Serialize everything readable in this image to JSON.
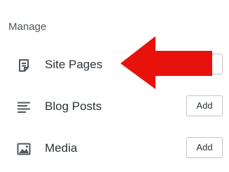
{
  "sidebar": {
    "section_title": "Manage",
    "items": [
      {
        "label": "Site Pages",
        "icon": "page-icon",
        "action_label": "Add"
      },
      {
        "label": "Blog Posts",
        "icon": "posts-icon",
        "action_label": "Add"
      },
      {
        "label": "Media",
        "icon": "media-icon",
        "action_label": "Add"
      }
    ]
  },
  "annotation": {
    "type": "arrow",
    "direction": "left",
    "color": "#e8120c"
  }
}
